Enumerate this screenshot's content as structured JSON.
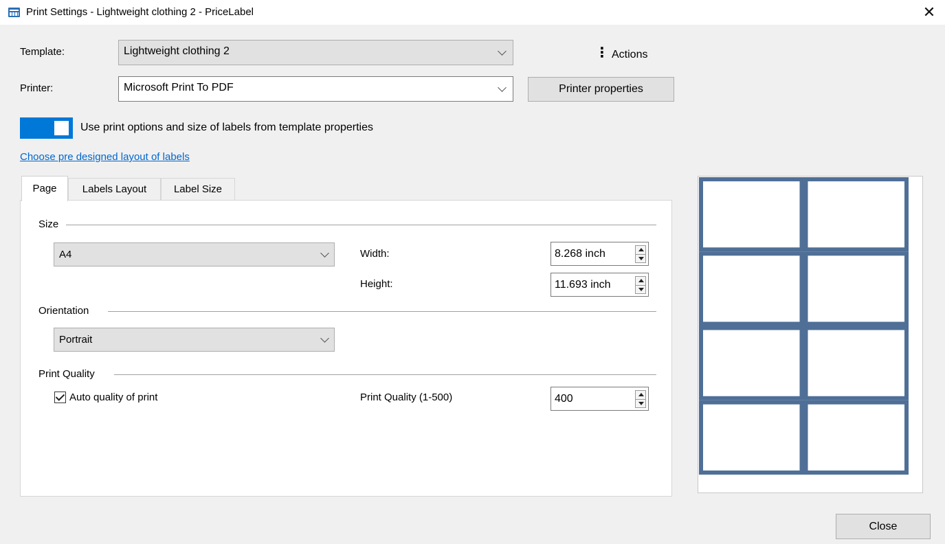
{
  "window": {
    "title": "Print Settings - Lightweight clothing 2 - PriceLabel",
    "app_icon": "label-app-icon",
    "close_glyph": "✕"
  },
  "template": {
    "label": "Template:",
    "value": "Lightweight clothing 2"
  },
  "printer": {
    "label": "Printer:",
    "value": "Microsoft Print To PDF",
    "properties_button": "Printer properties"
  },
  "actions": {
    "icon": "kebab-menu-icon",
    "glyph": "⋮",
    "label": "Actions"
  },
  "toggle": {
    "on": true,
    "label": "Use print options and size of labels from template properties",
    "color": "#0078d7"
  },
  "layout_link": "Choose pre designed layout of labels",
  "tabs": [
    {
      "label": "Page",
      "active": true
    },
    {
      "label": "Labels Layout",
      "active": false
    },
    {
      "label": "Label Size",
      "active": false
    }
  ],
  "page_tab": {
    "size_section": "Size",
    "paper_size": "A4",
    "width_label": "Width:",
    "width_value": "8.268 inch",
    "height_label": "Height:",
    "height_value": "11.693 inch",
    "orientation_section": "Orientation",
    "orientation_value": "Portrait",
    "quality_section": "Print Quality",
    "auto_quality_label": "Auto quality of print",
    "auto_quality_checked": true,
    "quality_label": "Print Quality (1-500)",
    "quality_value": "400"
  },
  "preview": {
    "columns": 2,
    "rows": 4,
    "line_color": "#4f6f97"
  },
  "close_button": "Close"
}
